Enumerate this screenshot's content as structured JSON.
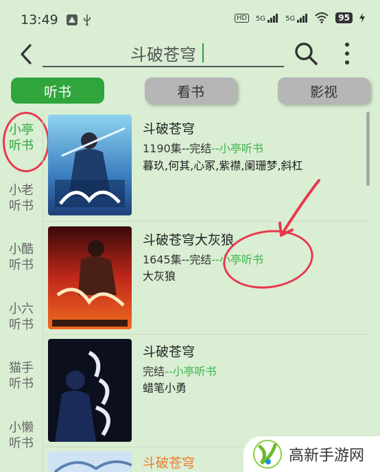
{
  "status": {
    "time": "13:49",
    "net1": "5G",
    "net2": "5G",
    "hd": "HD",
    "battery": "95"
  },
  "search": {
    "query": "斗破苍穹"
  },
  "tabs": [
    {
      "label": "听书",
      "active": true
    },
    {
      "label": "看书",
      "active": false
    },
    {
      "label": "影视",
      "active": false
    }
  ],
  "sidebar": {
    "items": [
      {
        "label": "小亭听书",
        "active": true
      },
      {
        "label": "小老听书",
        "active": false
      },
      {
        "label": "小酷听书",
        "active": false
      },
      {
        "label": "小六听书",
        "active": false
      },
      {
        "label": "猫手听书",
        "active": false
      },
      {
        "label": "小懒听书",
        "active": false
      }
    ]
  },
  "results": [
    {
      "title": "斗破苍穹",
      "meta_prefix": "1190集--完结",
      "source": "--小亭听书",
      "authors": "暮玖,何其,心冢,紫襟,阑珊梦,斜杠"
    },
    {
      "title": "斗破苍穹大灰狼",
      "meta_prefix": "1645集--完结",
      "source": "--小亭听书",
      "authors": "大灰狼"
    },
    {
      "title": "斗破苍穹",
      "meta_prefix": "完结",
      "source": "--小亭听书",
      "authors": "蜡笔小勇"
    },
    {
      "title": "斗破苍穹"
    }
  ],
  "watermark": {
    "text": "高新手游网"
  },
  "colors": {
    "background": "#d9eed3",
    "accent": "#2fa53b",
    "source_green": "#3bb34a",
    "annotation_red": "#e8384f",
    "orange_title": "#f07a2a"
  }
}
